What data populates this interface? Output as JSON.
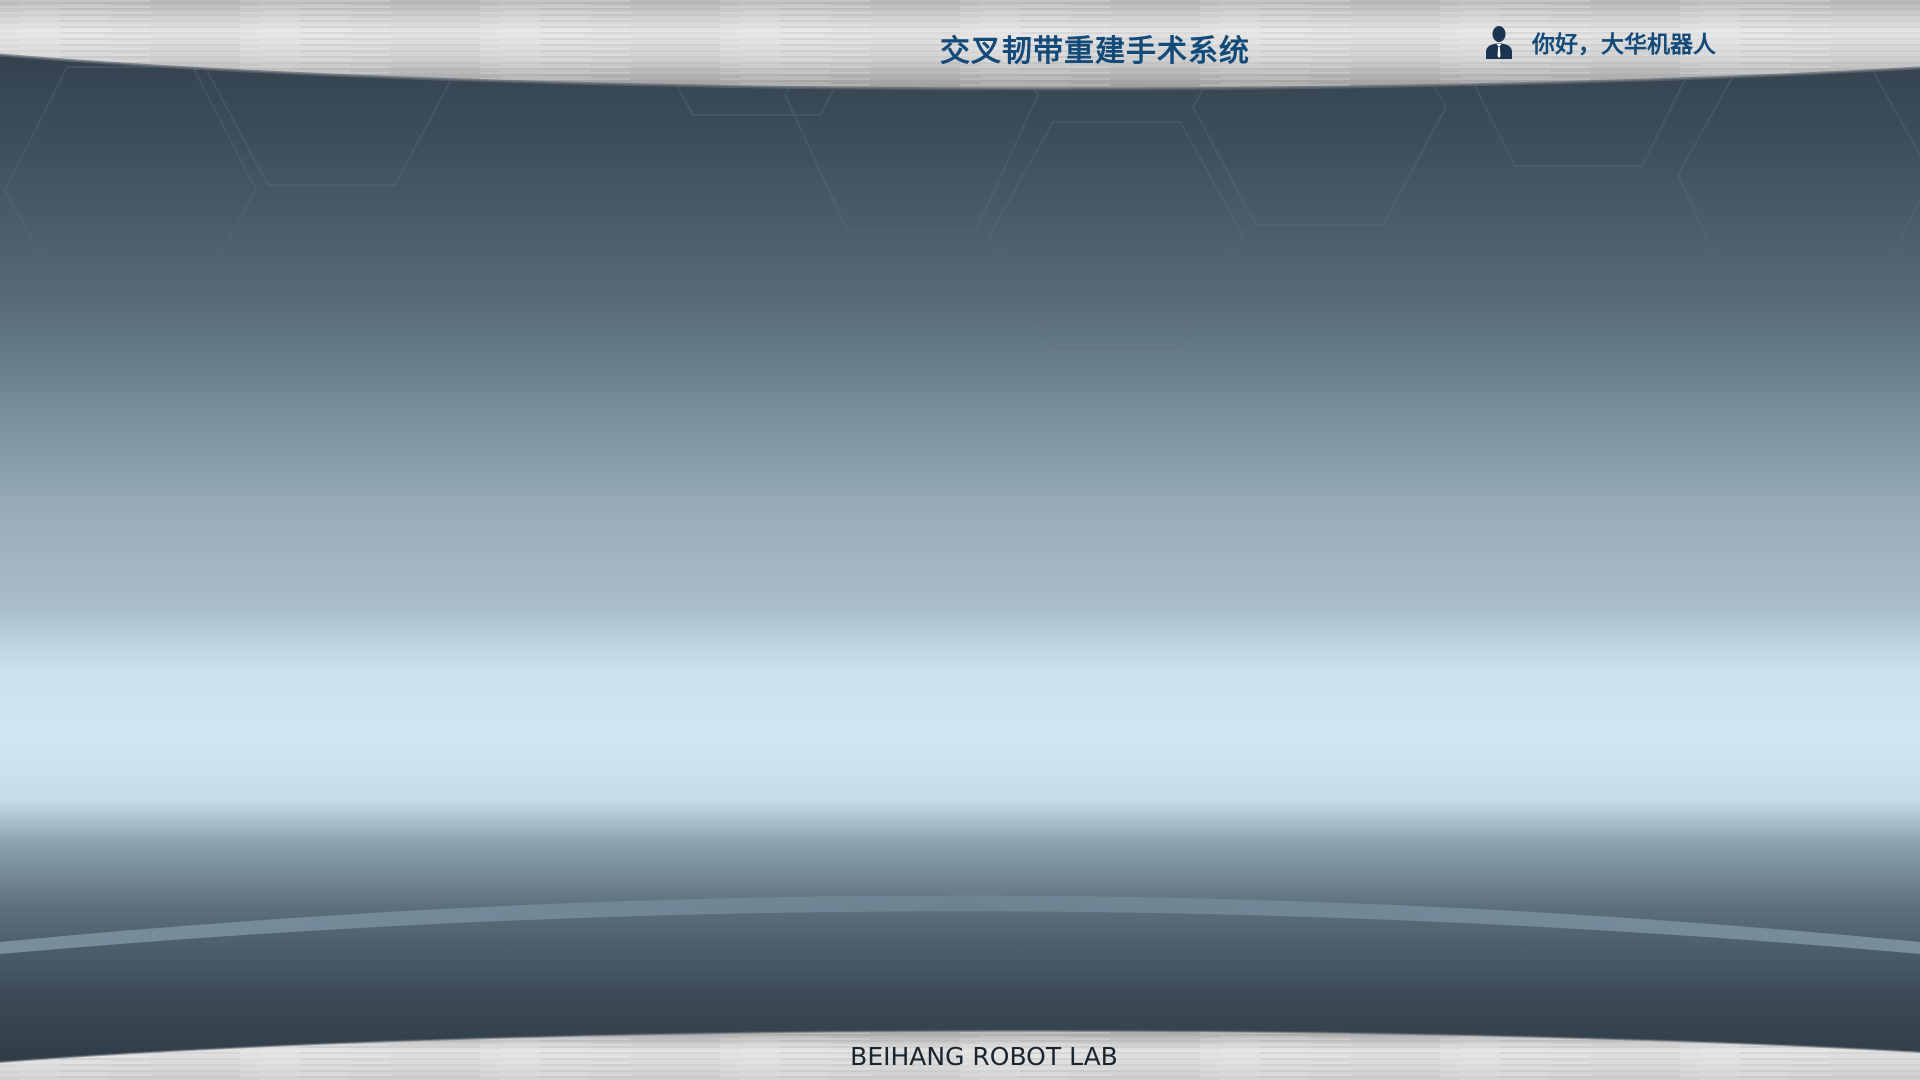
{
  "header": {
    "title": "交叉韧带重建手术系统",
    "user_greeting": "你好，大华机器人",
    "user_icon": "user-icon"
  },
  "footer": {
    "text": "BEIHANG ROBOT LAB"
  },
  "colors": {
    "title_text": "#144a78",
    "background_dark": "#2f3d48",
    "background_light": "#cfe6f1",
    "metal_bar": "#c9c9c9"
  }
}
